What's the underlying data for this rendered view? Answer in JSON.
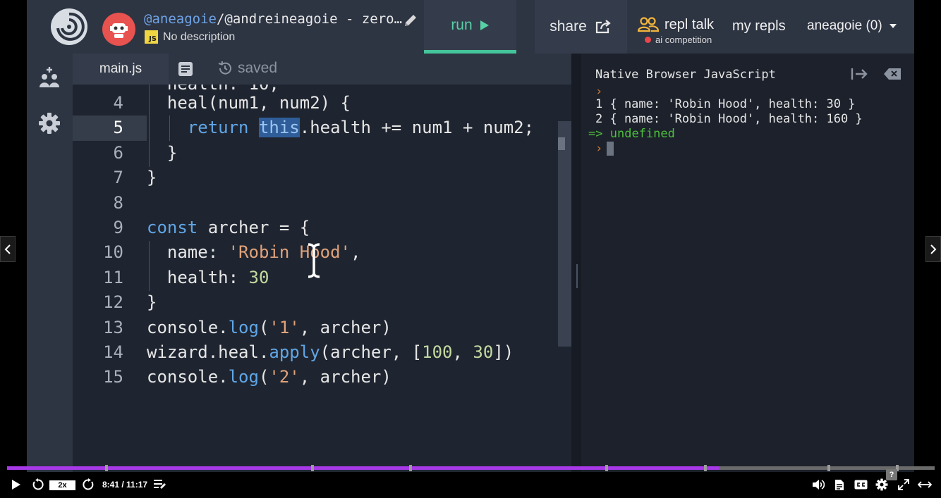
{
  "header": {
    "owner": "@aneagoie",
    "repl_path": "/@andreineagoie - zero…",
    "description_badge": "JS",
    "description": "No description",
    "run_label": "run",
    "share_label": "share",
    "repl_talk_label": "repl talk",
    "repl_talk_sub": "ai competition",
    "my_repls_label": "my repls",
    "user_label": "aneagoie (0)"
  },
  "tabs": {
    "main_file": "main.js",
    "saved_label": "saved"
  },
  "editor": {
    "lines": [
      {
        "n": "4",
        "parts": [
          [
            "",
            "  heal(num1, num2) {"
          ]
        ]
      },
      {
        "n": "5",
        "parts": [
          [
            "kw",
            "    return "
          ],
          [
            "sel",
            "this"
          ],
          [
            "",
            ".health += num1 + num2;"
          ]
        ]
      },
      {
        "n": "6",
        "parts": [
          [
            "",
            "  }"
          ]
        ]
      },
      {
        "n": "7",
        "parts": [
          [
            "",
            "}"
          ]
        ]
      },
      {
        "n": "8",
        "parts": [
          [
            "",
            ""
          ]
        ]
      },
      {
        "n": "9",
        "parts": [
          [
            "kw",
            "const"
          ],
          [
            "",
            " archer = {"
          ]
        ]
      },
      {
        "n": "10",
        "parts": [
          [
            "",
            "  name: "
          ],
          [
            "str",
            "'Robin Hood'"
          ],
          [
            "",
            ","
          ]
        ]
      },
      {
        "n": "11",
        "parts": [
          [
            "",
            "  health: "
          ],
          [
            "num-lit",
            "30"
          ]
        ]
      },
      {
        "n": "12",
        "parts": [
          [
            "",
            "}"
          ]
        ]
      },
      {
        "n": "13",
        "parts": [
          [
            "",
            "console."
          ],
          [
            "kw",
            "log"
          ],
          [
            "",
            "("
          ],
          [
            "str",
            "'1'"
          ],
          [
            "",
            ", archer)"
          ]
        ]
      },
      {
        "n": "14",
        "parts": [
          [
            "",
            "wizard.heal."
          ],
          [
            "kw",
            "apply"
          ],
          [
            "",
            "(archer, ["
          ],
          [
            "num-lit",
            "100"
          ],
          [
            "",
            ", "
          ],
          [
            "num-lit",
            "30"
          ],
          [
            "",
            "])"
          ]
        ]
      },
      {
        "n": "15",
        "parts": [
          [
            "",
            "console."
          ],
          [
            "kw",
            "log"
          ],
          [
            "",
            "("
          ],
          [
            "str",
            "'2'"
          ],
          [
            "",
            ", archer)"
          ]
        ]
      }
    ],
    "active_line": "5"
  },
  "console": {
    "title": "Native Browser JavaScript",
    "prompt": "›",
    "output_1": "1 { name: 'Robin Hood', health: 30 }",
    "output_2": "2 { name: 'Robin Hood', health: 160 }",
    "return_arrow": "=>",
    "return_value": "undefined"
  },
  "player": {
    "speed": "2x",
    "time": "8:41 / 11:17",
    "progress": 0.767,
    "help": "?"
  },
  "colors": {
    "accent_run": "#58d0a6",
    "progress": "#a839e8",
    "keyword": "#60a6e6",
    "string": "#e0a27a",
    "console_return": "#4fbf3d"
  },
  "icons": [
    "replit-logo-icon",
    "avatar-robot-icon",
    "pencil-icon",
    "play-icon",
    "share-icon",
    "people-icon",
    "add-user-icon",
    "gear-icon",
    "notes-icon",
    "history-icon",
    "collapse-icon",
    "clear-icon",
    "chevron-left-icon",
    "chevron-right-icon",
    "replay-icon",
    "forward-icon",
    "playlist-icon",
    "volume-icon",
    "transcript-icon",
    "captions-icon",
    "settings-icon",
    "fullscreen-icon",
    "expand-icon"
  ]
}
